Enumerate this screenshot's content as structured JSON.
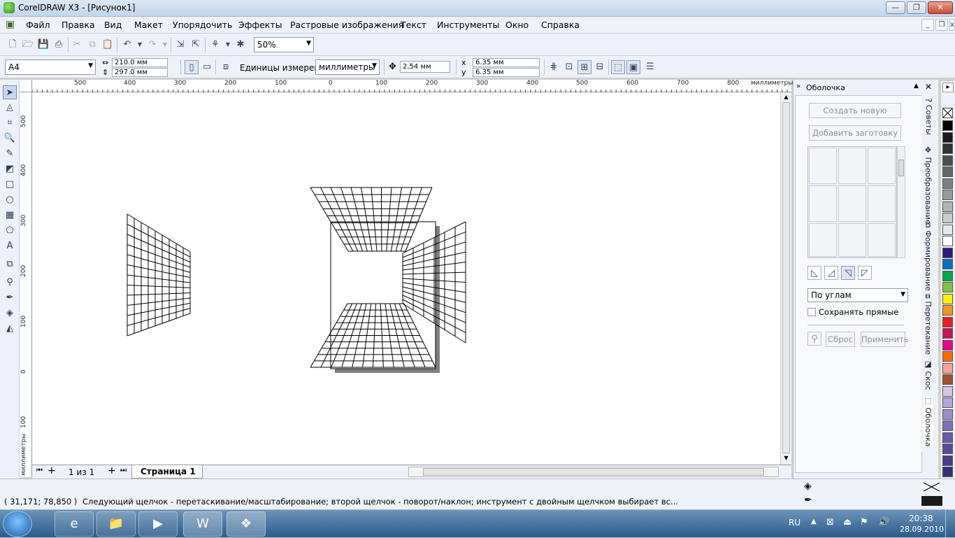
{
  "window": {
    "title": "CorelDRAW X3 - [Рисунок1]"
  },
  "menu": [
    "Файл",
    "Правка",
    "Вид",
    "Макет",
    "Упорядочить",
    "Эффекты",
    "Растровые изображения",
    "Текст",
    "Инструменты",
    "Окно",
    "Справка"
  ],
  "toolbar": {
    "zoom": "50%"
  },
  "propbar": {
    "page_size": "A4",
    "width": "210.0 мм",
    "height": "297.0 мм",
    "units_label": "Единицы измерения:",
    "units_value": "миллиметры",
    "nudge": "2,54 мм",
    "dup_x": "6.35 мм",
    "dup_y": "6.35 мм"
  },
  "ruler": {
    "top_ticks": [
      "500",
      "400",
      "300",
      "200",
      "100",
      "0",
      "100",
      "200",
      "300",
      "400",
      "500",
      "600",
      "700",
      "800"
    ],
    "top_unit": "миллиметры",
    "left_ticks": [
      "500",
      "400",
      "300",
      "200",
      "100",
      "0",
      "100"
    ],
    "left_unit": "миллиметры"
  },
  "pagebar": {
    "page_count": "1 из 1",
    "page_tab": "Страница 1"
  },
  "docker": {
    "title": "Оболочка",
    "create_new": "Создать новую",
    "add_preset": "Добавить заготовку",
    "mode": "По углам",
    "keep_lines": "Сохранять прямые",
    "reset": "Сброс",
    "apply": "Применить"
  },
  "side_tabs": [
    "Советы",
    "Преобразование",
    "Формирование",
    "Перетекание",
    "Скос",
    "Оболочка"
  ],
  "palette": [
    "#ffffff",
    "#000000",
    "#1a1a1a",
    "#333333",
    "#4d4d4d",
    "#666666",
    "#808080",
    "#999999",
    "#b3b3b3",
    "#cccccc",
    "#e6e6e6",
    "#ffffff",
    "#2e1a7a",
    "#0070c0",
    "#00a651",
    "#80c342",
    "#fff200",
    "#f7941d",
    "#ed1c24",
    "#c4145a",
    "#ec008c",
    "#ff6a00",
    "#f9a19a",
    "#a0522d",
    "#d8c4e6",
    "#b3a6d9",
    "#9b8dc9",
    "#7f70b9",
    "#6b5aa8",
    "#5a4a96",
    "#4a3c85",
    "#3a2e74"
  ],
  "status": {
    "coords": "( 31,171; 78,850 )",
    "message": "Следующий щелчок - перетаскивание/масштабирование; второй щелчок - поворот/наклон; инструмент с двойным щелчком выбирает вс..."
  },
  "taskbar": {
    "lang": "RU",
    "time": "20:38",
    "date": "28.09.2010"
  }
}
